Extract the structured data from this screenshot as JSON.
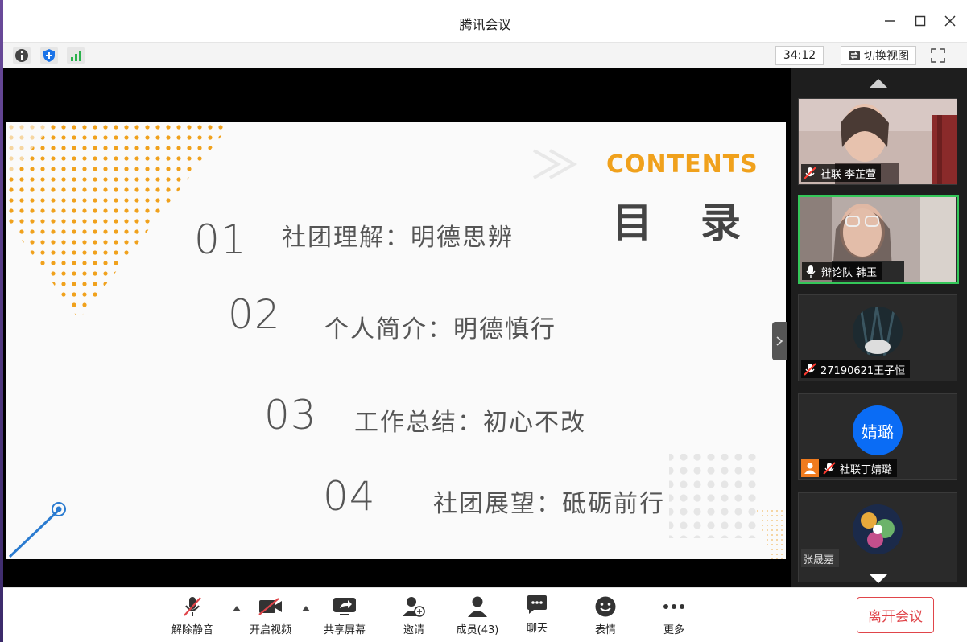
{
  "window": {
    "title": "腾讯会议",
    "controls": [
      "minimize",
      "maximize",
      "close"
    ]
  },
  "infobar": {
    "icons": [
      "info-icon",
      "shield-icon",
      "signal-icon"
    ],
    "timer": "34:12",
    "switch_view_label": "切换视图"
  },
  "slide": {
    "contents_en": "CONTENTS",
    "contents_zh": "目录",
    "items": [
      {
        "num": "01",
        "text": "社团理解：明德思辨"
      },
      {
        "num": "02",
        "text": "个人简介：明德慎行"
      },
      {
        "num": "03",
        "text": "工作总结：初心不改"
      },
      {
        "num": "04",
        "text": "社团展望：砥砺前行"
      }
    ],
    "accent_color": "#f0a11c",
    "line_color": "#2a7bd0"
  },
  "participants": [
    {
      "name": "社联 李芷萱",
      "muted": true
    },
    {
      "name": "辩论队  韩玉",
      "muted": false,
      "speaking": true
    },
    {
      "name": "27190621王子恒",
      "muted": true
    },
    {
      "name": "社联丁婧璐",
      "muted": true,
      "avatar_text": "婧璐",
      "avatar_color": "#0a6cf5"
    },
    {
      "name": "张晟嘉",
      "muted": false
    }
  ],
  "toolbar": {
    "mute_label": "解除静音",
    "video_label": "开启视频",
    "share_label": "共享屏幕",
    "invite_label": "邀请",
    "members_label": "成员(43)",
    "chat_label": "聊天",
    "reaction_label": "表情",
    "more_label": "更多",
    "leave_label": "离开会议"
  },
  "colors": {
    "leave_red": "#e0454a",
    "speaking_green": "#34c759"
  }
}
